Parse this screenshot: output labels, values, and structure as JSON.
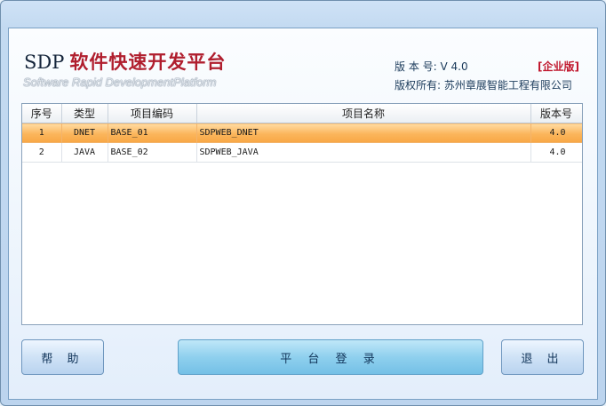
{
  "brand": {
    "prefix": "SDP",
    "title_cn": "软件快速开发平台",
    "subtitle": "Software Rapid DevelopmentPlatform"
  },
  "info": {
    "version_label": "版 本 号:",
    "version_value": "V 4.0",
    "edition": "[企业版]",
    "copyright": "版权所有: 苏州章展智能工程有限公司"
  },
  "grid": {
    "headers": [
      "序号",
      "类型",
      "项目编码",
      "项目名称",
      "版本号"
    ],
    "rows": [
      [
        "1",
        "DNET",
        "BASE_01",
        "SDPWEB_DNET",
        "4.0"
      ],
      [
        "2",
        "JAVA",
        "BASE_02",
        "SDPWEB_JAVA",
        "4.0"
      ]
    ],
    "selected_row": 0
  },
  "buttons": {
    "help": "帮 助",
    "login": "平 台 登 录",
    "exit": "退 出"
  },
  "colors": {
    "title_red": "#b01e2e",
    "selected_row": "#fbb55b",
    "login_button": "#8fd0ee"
  }
}
